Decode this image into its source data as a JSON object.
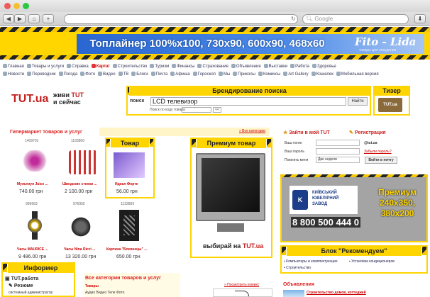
{
  "browser": {
    "search_placeholder": "Google",
    "nav_back": "◀",
    "nav_fwd": "▶",
    "home": "⌂",
    "add": "+"
  },
  "top_banner": {
    "text": "Топлайнер 100%х100, 730х90, 600х90, 468х60",
    "brand": "Fito - Lida",
    "brand_sub": "товары для похудения"
  },
  "nav_row1": [
    "Главная",
    "Товары и услуги",
    "Справка",
    "Карта!",
    "Строительство",
    "Туризм",
    "Финансы",
    "Страхование",
    "Объявления",
    "Выставки",
    "Работа",
    "Здоровье"
  ],
  "nav_row2": [
    "Новости",
    "Переводчик",
    "Погода",
    "Фото",
    "Видео",
    "ТВ",
    "Блоги",
    "Почта",
    "Афиша",
    "Гороскоп",
    "Мы",
    "Приколы",
    "Комиксы",
    "Art Gallery",
    "Кошелек",
    "Мобильная версия"
  ],
  "header": {
    "logo": "TUT.ua",
    "slogan1": "живи",
    "slogan_tut": "TUT",
    "slogan2": "и сейчас"
  },
  "search": {
    "title": "Брендирование поиска",
    "label": "поиск",
    "value": "LCD телевизор",
    "button": "Найти",
    "hint": "Поиск по коду товара",
    "go": "<<"
  },
  "teaser": {
    "title": "Тизер",
    "logo": "TUT.ua"
  },
  "hyper": {
    "title": "Гипермаркет товаров и услуг",
    "all_link": "» Все категории",
    "products": [
      {
        "code": "1409701",
        "name": "Мультиул Juice ...",
        "price": "740.00 грн"
      },
      {
        "code": "1193800",
        "name": "Шведские стенки ...",
        "price": "2 100.00 грн"
      },
      {
        "code": "999663",
        "name": "Часы MAURICE ...",
        "price": "9 486.00 грн"
      },
      {
        "code": "976955",
        "name": "Часы Nina Ricci ...",
        "price": "13 320.00 грн"
      },
      {
        "code": "1132869",
        "name": "Картина \"Близнецы\" ...",
        "price": "650.00 грн"
      }
    ],
    "tovar": {
      "title": "Товар",
      "name": "Идеал Форте",
      "price": "56.00 грн"
    }
  },
  "premium": {
    "title": "Премиум товар",
    "caption": "выбирай на",
    "logo": "TUT.ua"
  },
  "login": {
    "enter": "Зайти в мой TUT",
    "register": "Регистрация",
    "name_label": "Ваш логин",
    "domain": "@tut.ua",
    "pass_label": "Ваш пароль",
    "forgot": "Забыли пароль?",
    "remember_label": "Помнить меня",
    "remember_value": "Две недели",
    "submit": "Войти в почту"
  },
  "premium_ad": {
    "name": "КИЇВСЬКИЙ ЮВЕЛІРНИЙ ЗАВОД",
    "phone": "8 800 500 444 0",
    "label1": "Премиум",
    "label2": "240х350,",
    "label3": "380х200"
  },
  "recommend": {
    "title": "Блок \"Рекомендуем\"",
    "items": [
      "Компьютеры и комплектующие",
      "Установка кондиционеров",
      "Строительство"
    ]
  },
  "informer": {
    "title": "Информер",
    "item1": "TUT.работа",
    "item2": "Резюме",
    "item3": "системный администратор"
  },
  "categories": {
    "title": "Все категории товаров и услуг",
    "items": [
      "Товары",
      "Аудио Видео Теле Фото"
    ]
  },
  "comics": {
    "link": "» Посмотреть комикс"
  },
  "ads": {
    "title": "Объявления",
    "item": "Строительство домов, коттеджей"
  }
}
